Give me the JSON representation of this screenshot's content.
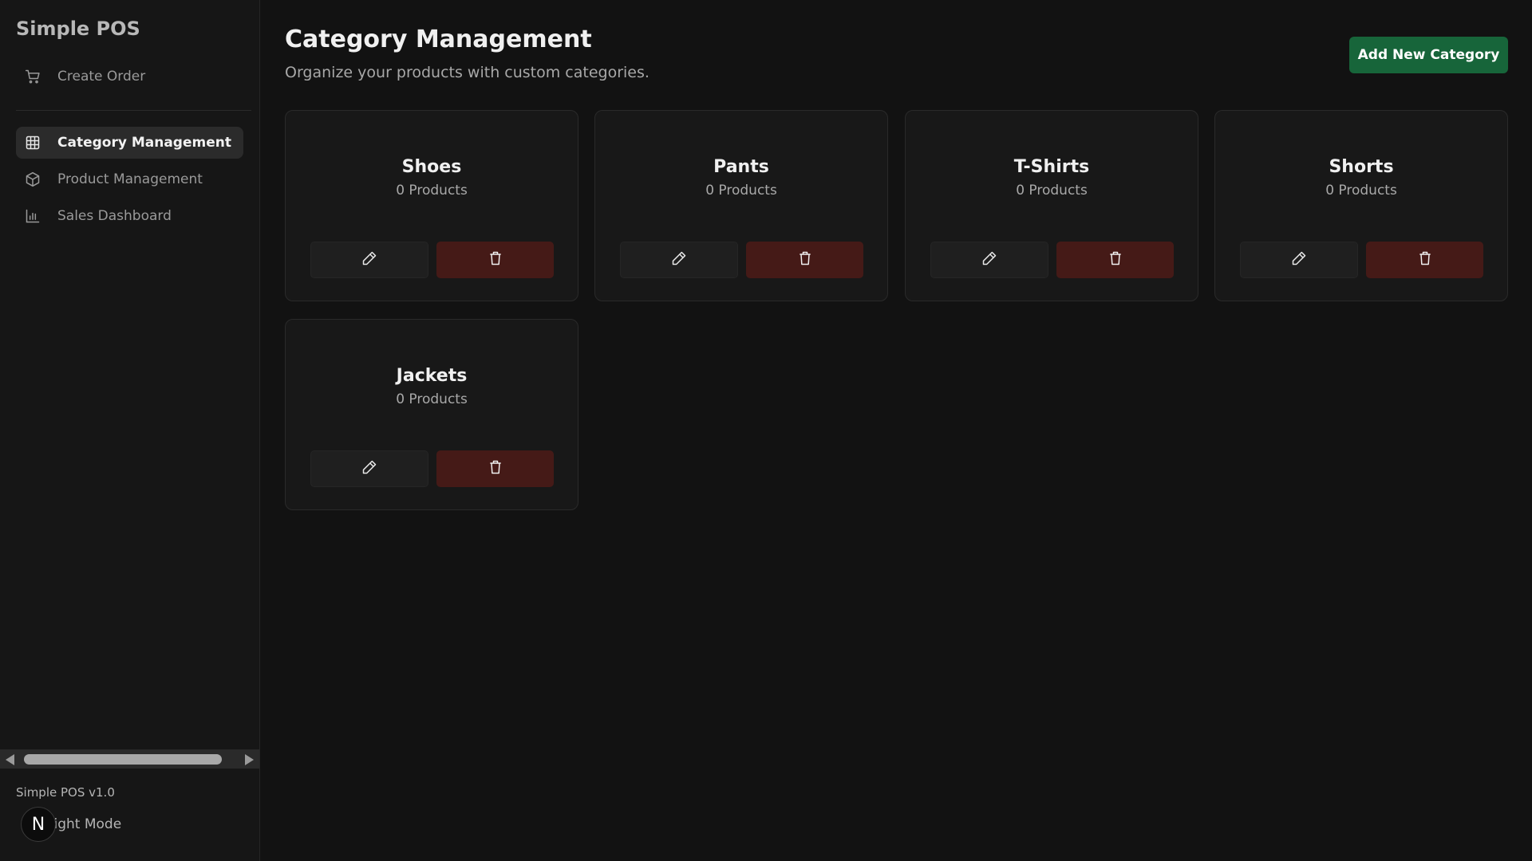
{
  "sidebar": {
    "brand": "Simple POS",
    "top_item": {
      "label": "Create Order",
      "icon": "cart-icon"
    },
    "items": [
      {
        "label": "Category Management",
        "icon": "grid-icon",
        "active": true
      },
      {
        "label": "Product Management",
        "icon": "box-icon",
        "active": false
      },
      {
        "label": "Sales Dashboard",
        "icon": "bar-chart-icon",
        "active": false
      }
    ],
    "version": "Simple POS v1.0",
    "mode_label": "Light Mode",
    "avatar_letter": "N"
  },
  "header": {
    "title": "Category Management",
    "subtitle": "Organize your products with custom categories.",
    "add_button": "Add New Category"
  },
  "categories": [
    {
      "name": "Shoes",
      "count": "0 Products"
    },
    {
      "name": "Pants",
      "count": "0 Products"
    },
    {
      "name": "T-Shirts",
      "count": "0 Products"
    },
    {
      "name": "Shorts",
      "count": "0 Products"
    },
    {
      "name": "Jackets",
      "count": "0 Products"
    }
  ],
  "colors": {
    "background": "#121212",
    "accent_green": "#17653a",
    "delete_red": "#451a17"
  }
}
